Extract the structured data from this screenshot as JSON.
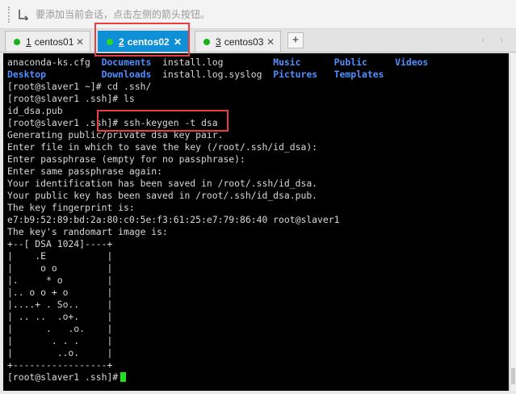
{
  "hint_bar": {
    "text": "要添加当前会话，点击左侧的箭头按钮。"
  },
  "tabs": [
    {
      "index": "1",
      "name": "centos01",
      "active": false
    },
    {
      "index": "2",
      "name": "centos02",
      "active": true
    },
    {
      "index": "3",
      "name": "centos03",
      "active": false
    }
  ],
  "new_tab_label": "+",
  "nav_arrows": "‹ ›",
  "colors": {
    "accent": "#0e8fd6",
    "status_dot": "#19b219",
    "highlight": "#e83e3e",
    "terminal_bg": "#000000",
    "dir_blue": "#4f8fff"
  },
  "terminal": {
    "ls_row1": {
      "f1": "anaconda-ks.cfg",
      "f2": "Documents",
      "f3": "install.log",
      "f4": "Music",
      "f5": "Public",
      "f6": "Videos"
    },
    "ls_row2": {
      "f1": "Desktop",
      "f2": "Downloads",
      "f3": "install.log.syslog",
      "f4": "Pictures",
      "f5": "Templates"
    },
    "lines": [
      "[root@slaver1 ~]# cd .ssh/",
      "[root@slaver1 .ssh]# ls",
      "id_dsa.pub",
      "[root@slaver1 .ssh]# ssh-keygen -t dsa",
      "Generating public/private dsa key pair.",
      "Enter file in which to save the key (/root/.ssh/id_dsa):",
      "Enter passphrase (empty for no passphrase):",
      "Enter same passphrase again:",
      "Your identification has been saved in /root/.ssh/id_dsa.",
      "Your public key has been saved in /root/.ssh/id_dsa.pub.",
      "The key fingerprint is:",
      "e7:b9:52:89:bd:2a:80:c0:5e:f3:61:25:e7:79:86:40 root@slaver1",
      "The key's randomart image is:",
      "+--[ DSA 1024]----+",
      "|    .E           |",
      "|     o o         |",
      "|.     * o        |",
      "|.. o o + o       |",
      "|....+ . So..     |",
      "| .. ..  .o+.     |",
      "|      .   .o.    |",
      "|       . . .     |",
      "|        ..o.     |",
      "+-----------------+"
    ],
    "prompt": "[root@slaver1 .ssh]#"
  }
}
